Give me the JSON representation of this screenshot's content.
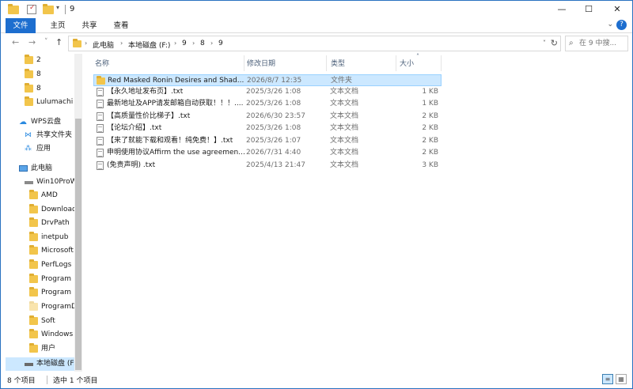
{
  "title": "9",
  "ribbon": {
    "tabs": [
      "文件",
      "主页",
      "共享",
      "查看"
    ]
  },
  "nav": {
    "back_icon": "←",
    "forward_icon": "→",
    "recent_icon": "˅",
    "up_icon": "↑",
    "breadcrumbs": [
      "此电脑",
      "本地磁盘 (F:)",
      "9",
      "8",
      "9"
    ],
    "search_placeholder": "在 9 中搜..."
  },
  "navpane": {
    "items": [
      {
        "label": "2",
        "icon": "folder-icon"
      },
      {
        "label": "8",
        "icon": "folder-icon"
      },
      {
        "label": "8",
        "icon": "folder-icon"
      },
      {
        "label": "Lulumachi",
        "icon": "folder-icon"
      },
      {
        "label": "WPS云盘",
        "icon": "cloud-icon"
      },
      {
        "label": "共享文件夹",
        "icon": "share-icon"
      },
      {
        "label": "应用",
        "icon": "apps-icon"
      },
      {
        "label": "此电脑",
        "icon": "computer-icon"
      },
      {
        "label": "Win10ProW",
        "icon": "drive-icon"
      },
      {
        "label": "AMD",
        "icon": "folder-icon"
      },
      {
        "label": "Download",
        "icon": "folder-icon"
      },
      {
        "label": "DrvPath",
        "icon": "folder-icon"
      },
      {
        "label": "inetpub",
        "icon": "folder-icon"
      },
      {
        "label": "Microsoft",
        "icon": "folder-icon"
      },
      {
        "label": "PerfLogs",
        "icon": "folder-icon"
      },
      {
        "label": "Program",
        "icon": "folder-icon"
      },
      {
        "label": "Program",
        "icon": "folder-icon"
      },
      {
        "label": "ProgramD",
        "icon": "folder-icon"
      },
      {
        "label": "Soft",
        "icon": "folder-icon"
      },
      {
        "label": "Windows",
        "icon": "folder-icon"
      },
      {
        "label": "用户",
        "icon": "folder-icon"
      },
      {
        "label": "本地磁盘 (F:",
        "icon": "drive-icon",
        "selected": true
      }
    ]
  },
  "columns": {
    "name": "名称",
    "date": "修改日期",
    "type": "类型",
    "size": "大小"
  },
  "files": [
    {
      "name": "Red Masked Ronin Desires and Shad...",
      "date": "2026/8/7 12:35",
      "type": "文件夹",
      "size": "",
      "icon": "folder-icon",
      "selected": true
    },
    {
      "name": "【永久地址发布页】.txt",
      "date": "2025/3/26 1:08",
      "type": "文本文档",
      "size": "1 KB",
      "icon": "txt-icon"
    },
    {
      "name": "最新地址及APP请发邮箱自动获取！！！....",
      "date": "2025/3/26 1:08",
      "type": "文本文档",
      "size": "1 KB",
      "icon": "txt-icon"
    },
    {
      "name": "【高质量性价比梯子】.txt",
      "date": "2026/6/30 23:57",
      "type": "文本文档",
      "size": "2 KB",
      "icon": "txt-icon"
    },
    {
      "name": "【论坛介绍】.txt",
      "date": "2025/3/26 1:08",
      "type": "文本文档",
      "size": "2 KB",
      "icon": "txt-icon"
    },
    {
      "name": "【来了就能下载和观看！纯免费！】.txt",
      "date": "2025/3/26 1:07",
      "type": "文本文档",
      "size": "2 KB",
      "icon": "txt-icon"
    },
    {
      "name": "申明使用协议Affirm the use agreemen...",
      "date": "2026/7/31 4:40",
      "type": "文本文档",
      "size": "2 KB",
      "icon": "txt-icon"
    },
    {
      "name": "(免责声明) .txt",
      "date": "2025/4/13 21:47",
      "type": "文本文档",
      "size": "3 KB",
      "icon": "txt-icon"
    }
  ],
  "status": {
    "count": "8 个项目",
    "selected": "选中 1 个项目"
  }
}
